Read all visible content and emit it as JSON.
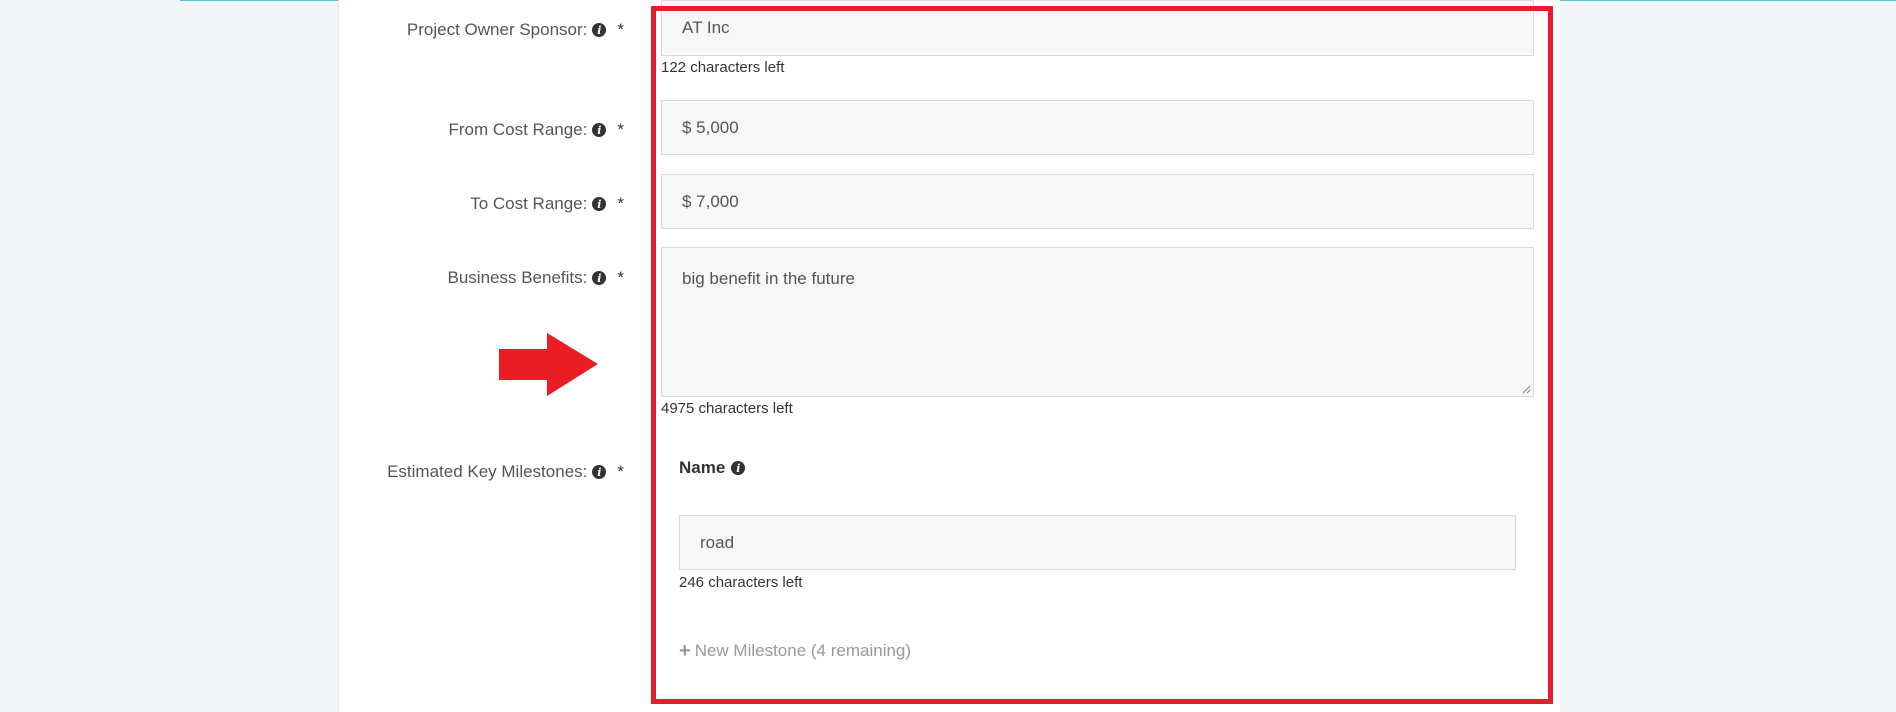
{
  "form": {
    "sponsor": {
      "label": "Project Owner Sponsor:",
      "required": "*",
      "value": "AT Inc",
      "helper": "122 characters left"
    },
    "from_cost": {
      "label": "From Cost Range:",
      "required": "*",
      "value": "$ 5,000"
    },
    "to_cost": {
      "label": "To Cost Range:",
      "required": "*",
      "value": "$ 7,000"
    },
    "benefits": {
      "label": "Business Benefits:",
      "required": "*",
      "value": "big benefit in the future",
      "helper": "4975 characters left"
    },
    "milestones": {
      "label": "Estimated Key Milestones:",
      "required": "*",
      "column_header": "Name",
      "items": [
        {
          "name": "road",
          "helper": "246 characters left"
        }
      ],
      "add_label": "New Milestone (4 remaining)"
    }
  },
  "icons": {
    "info": "info-circle-icon",
    "plus": "plus-icon",
    "arrow": "arrow-right-icon"
  },
  "colors": {
    "highlight": "#e41f2b",
    "arrow": "#ec1c24",
    "accent": "#5bc0de"
  }
}
